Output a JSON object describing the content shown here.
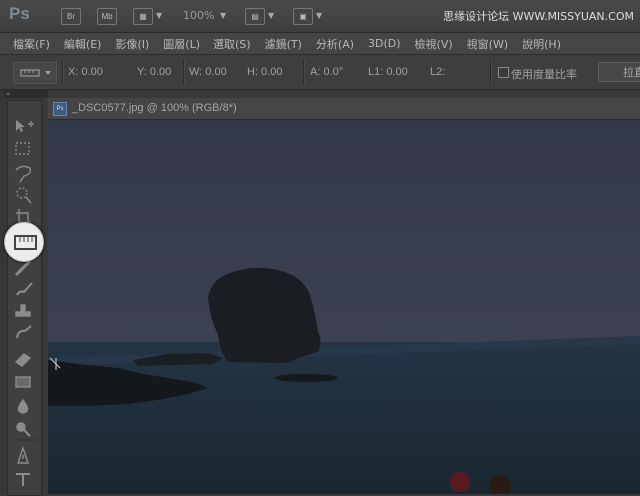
{
  "appbar": {
    "logo": "Ps",
    "bridge_label": "Br",
    "minibridge_label": "Mb",
    "zoom": "100%",
    "watermark": "思缘设计论坛 WWW.MISSYUAN.COM"
  },
  "menu": {
    "items": [
      "檔案(F)",
      "編輯(E)",
      "影像(I)",
      "圖層(L)",
      "選取(S)",
      "濾鏡(T)",
      "分析(A)",
      "3D(D)",
      "檢視(V)",
      "視窗(W)",
      "說明(H)"
    ]
  },
  "options": {
    "x": "X: 0.00",
    "y": "Y: 0.00",
    "w": "W: 0.00",
    "h": "H: 0.00",
    "a": "A: 0.0°",
    "l1": "L1: 0.00",
    "l2": "L2:",
    "use_scale": "使用度量比率",
    "straighten": "拉直"
  },
  "toolbox": {
    "collapse": "»"
  },
  "document": {
    "icon_label": "Ps",
    "title": "_DSC0577.jpg @ 100% (RGB/8*)"
  },
  "colors": {
    "accent": "#3d5c82",
    "panel": "#404040",
    "sky": "#3a3f4e",
    "sea": "#1f2f3d"
  }
}
